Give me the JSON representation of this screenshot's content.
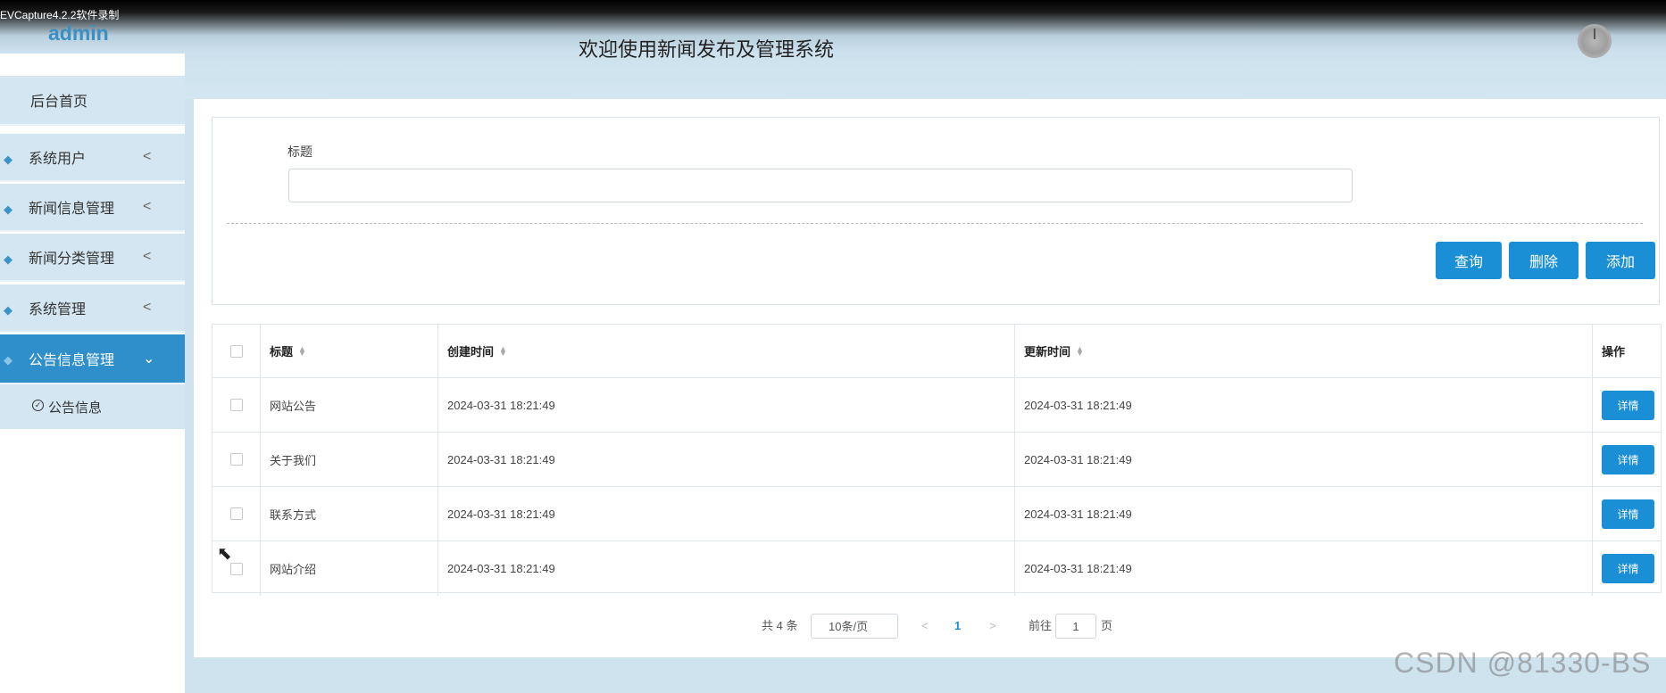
{
  "recorder": {
    "label": "EVCapture4.2.2软件录制"
  },
  "header": {
    "user": "admin",
    "title": "欢迎使用新闻发布及管理系统"
  },
  "sidebar": {
    "items": [
      {
        "label": "后台首页"
      },
      {
        "label": "系统用户",
        "chevron": "<"
      },
      {
        "label": "新闻信息管理",
        "chevron": "<"
      },
      {
        "label": "新闻分类管理",
        "chevron": "<"
      },
      {
        "label": "系统管理",
        "chevron": "<"
      },
      {
        "label": "公告信息管理",
        "chevron": "⌄",
        "active": true
      }
    ],
    "sub_item": {
      "label": "公告信息",
      "icon": "check-circle-icon"
    }
  },
  "search": {
    "label": "标题",
    "value": "",
    "placeholder": ""
  },
  "buttons": {
    "query": "查询",
    "delete": "删除",
    "add": "添加"
  },
  "table": {
    "columns": [
      "标题",
      "创建时间",
      "更新时间",
      "操作"
    ],
    "rows": [
      {
        "title": "网站公告",
        "created": "2024-03-31 18:21:49",
        "updated": "2024-03-31 18:21:49",
        "action": "详情"
      },
      {
        "title": "关于我们",
        "created": "2024-03-31 18:21:49",
        "updated": "2024-03-31 18:21:49",
        "action": "详情"
      },
      {
        "title": "联系方式",
        "created": "2024-03-31 18:21:49",
        "updated": "2024-03-31 18:21:49",
        "action": "详情"
      },
      {
        "title": "网站介绍",
        "created": "2024-03-31 18:21:49",
        "updated": "2024-03-31 18:21:49",
        "action": "详情"
      }
    ]
  },
  "pagination": {
    "total": "共 4 条",
    "page_size": "10条/页",
    "prev": "<",
    "current": "1",
    "next": ">",
    "goto": "前往",
    "goto_value": "1",
    "page": "页"
  },
  "watermark": "CSDN @81330-BS",
  "colors": {
    "accent": "#1a8fd6",
    "sidebar_active": "#2f8fcb",
    "sidebar_bg": "#d3e6f1"
  }
}
